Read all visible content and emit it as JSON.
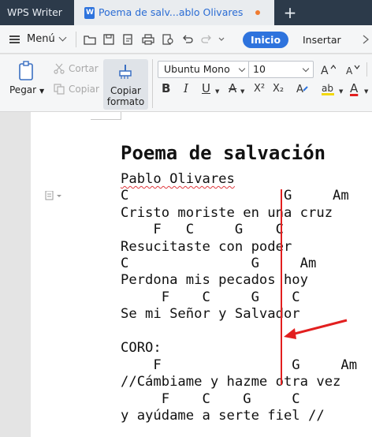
{
  "tabs": {
    "app": "WPS Writer",
    "document": "Poema de salv...ablo Olivares",
    "add": "+"
  },
  "menu": {
    "label": "Menú",
    "tabs": [
      {
        "label": "Inicio",
        "active": true
      },
      {
        "label": "Insertar",
        "active": false
      }
    ]
  },
  "ribbon": {
    "paste": "Pegar",
    "cut": "Cortar",
    "copy": "Copiar",
    "format_painter": [
      "Copiar",
      "formato"
    ],
    "font": "Ubuntu Mono",
    "font_size": "10",
    "formatting": [
      "B",
      "I",
      "U",
      "A",
      "X²",
      "X₂",
      "A"
    ]
  },
  "document": {
    "title": "Poema de salvación",
    "lines": [
      "Pablo Olivares",
      "C                   G     Am",
      "Cristo moriste en una cruz",
      "    F   C     G    C",
      "Resucitaste con poder",
      "C               G     Am",
      "Perdona mis pecados hoy",
      "     F    C     G    C",
      "Se mi Señor y Salvador",
      "",
      "CORO:",
      "    F                G     Am",
      "//Cámbiame y hazme otra vez",
      "     F    C    G     C",
      "y ayúdame a serte fiel //"
    ]
  },
  "colors": {
    "accent": "#2e73dd",
    "tabbar": "#2c3a4a",
    "annotation": "#e21f1f",
    "unsaved_dot": "#f07b30"
  }
}
